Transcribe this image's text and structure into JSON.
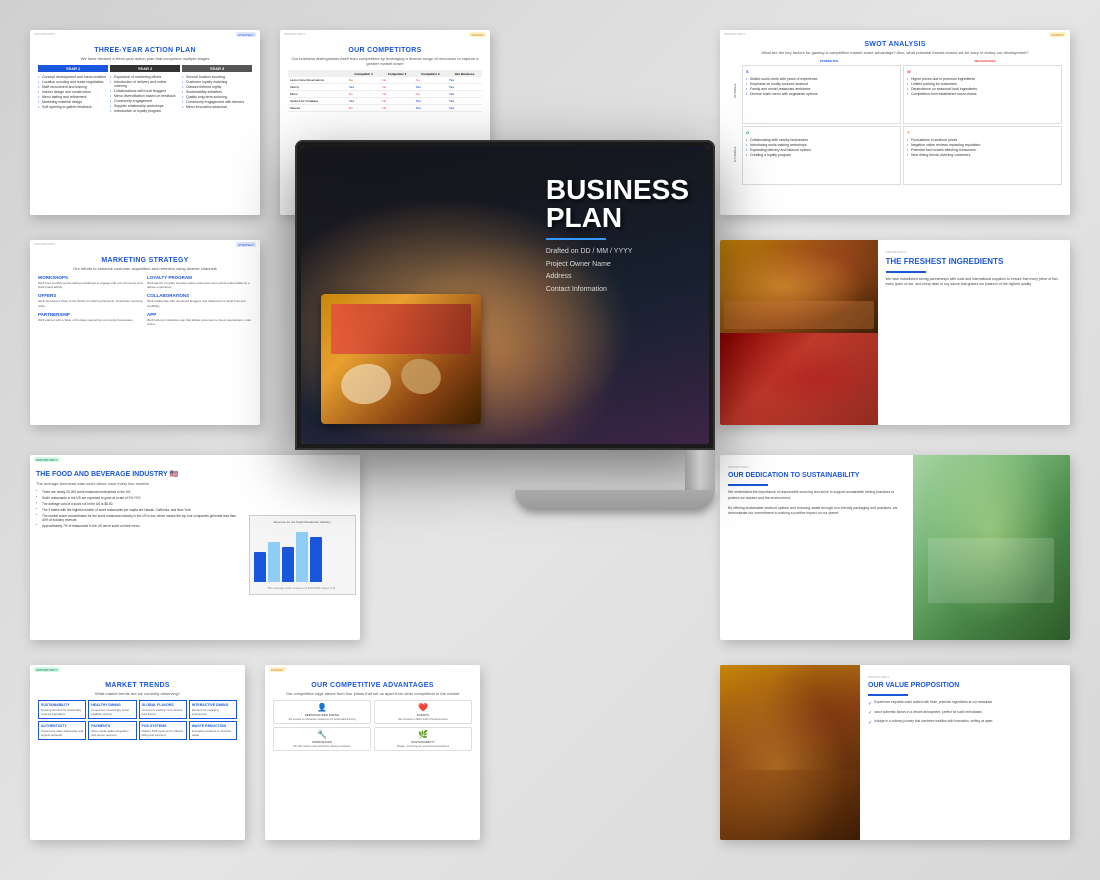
{
  "slides": {
    "action_plan": {
      "label": "STRATEGY",
      "title": "THREE-YEAR ACTION PLAN",
      "subtitle": "We have devised a three-year action plan that comprises multiple stages",
      "year1": "YEAR 1",
      "year2": "YEAR 2",
      "year3": "YEAR 3",
      "year1_items": [
        "Concept development and menu creation",
        "Location scouting and lease negotiation",
        "Staff recruitment and training initiation",
        "Interior design and construction commencement",
        "Menu tasting and refinement",
        "Marketing material design and branding",
        "Soft opening to gather feedback"
      ],
      "year2_items": [
        "Expansion of marketing efforts",
        "Introduction of delivery and online ordering",
        "Collaborations with local food bloggers",
        "Menu diversification based on customer feedback",
        "Community engagement and partnerships",
        "Supplier relationship workshops",
        "Introduction of loyalty program"
      ],
      "year3_items": [
        "Second location scouting and preparation",
        "Customer loyalty matching",
        "Classes themed nights",
        "Sustainability initiatives",
        "Strategies for quality long-term sourcing",
        "Community engagement with local suppliers and farmers",
        "Menu innovation and seasonal offerings"
      ]
    },
    "competitors": {
      "label": "MARKET",
      "title": "OUR COMPETITORS",
      "subtitle": "Our business distinguishes itself from competitors by leveraging a diverse range of resources to capture a greater market share",
      "columns": [
        "",
        "Competitor 1",
        "Competitor 2",
        "Competitor 3",
        "Our Business"
      ],
      "rows": [
        {
          "feature": "Last-minute Reservations",
          "c1": "No",
          "c2": "No",
          "c3": "No",
          "us": "Yes"
        },
        {
          "feature": "Variety",
          "c1": "Yes",
          "c2": "No",
          "c3": "Yes",
          "us": "Yes"
        },
        {
          "feature": "Menu",
          "c1": "No",
          "c2": "No",
          "c3": "No",
          "us": "Yes"
        },
        {
          "feature": "Options for Omakase",
          "c1": "Yes",
          "c2": "No",
          "c3": "Yes",
          "us": "Yes"
        },
        {
          "feature": "Sauces",
          "c1": "No",
          "c2": "No",
          "c3": "Yes",
          "us": "Yes"
        }
      ]
    },
    "swot": {
      "label": "MARKET",
      "title": "SWOT ANALYSIS",
      "subtitle": "What are the key factors for gaining a competitive market share advantage? Also, what potential threats should we be wary of during our development?",
      "strengths_title": "STRENGTHS",
      "weaknesses_title": "WEAKNESSES",
      "opportunities_title": "OPPORTUNITIES",
      "threats_title": "THREATS",
      "internal_label": "INTERNAL",
      "external_label": "EXTERNAL",
      "strengths": [
        "Skilled sushi chefs with years of experience",
        "Emphasis on using locally sourced seafood",
        "Family and model restaurant ambiance",
        "Diverse sushi menu with vegetarian options"
      ],
      "weaknesses": [
        "Higher prices due to premium ingredients",
        "Limited parking for customers",
        "Dependence on seasonal local ingredients",
        "May face competition from established sushi chains"
      ],
      "opportunities": [
        "Collaborating with nearby businesses for lunch specials",
        "Introducing sushi-making workshops for customers",
        "Expanding delivery and takeout options",
        "Creating a loyalty program to encourage repeat visits"
      ],
      "threats": [
        "Fluctuations in seafood prices due to supply chain issues",
        "Negative online reviews impacting reputation",
        "Potential food scares affecting consumer consumption",
        "Emergence of new dining trends diverting customer"
      ]
    },
    "marketing": {
      "label": "STRATEGY",
      "title": "MARKETING STRATEGY",
      "subtitle": "Our efforts to enhance customer acquisition and retention using diverse channels",
      "items": [
        {
          "title": "WORKSHOPS",
          "text": "We'll host monthly sushi-making workshops to engage with our community and build brand affinity."
        },
        {
          "title": "LOYALTY PROGRAM",
          "text": "We'll launch a loyalty program where customers earn points for a minimum spend, redeemable for a deluxe omakase experience."
        },
        {
          "title": "OFFERS",
          "text": "We'll introduce a Taste of the World cut offering discounts. Incentivize recurring visits."
        },
        {
          "title": "COLLABORATIONS",
          "text": "We'll collaborate with renowned high-profile bloggers and influencers to build trust and credibility."
        },
        {
          "title": "PARTNERSHIP",
          "text": "We'll partner with a Taste of the East supporting community businesses."
        },
        {
          "title": "APP",
          "text": "We'll build an interactive app that allows customers to book reservations, order online."
        }
      ]
    },
    "freshest": {
      "label": "OPPORTUNITY",
      "title": "THE FRESHEST INGREDIENTS",
      "text": "We have established strong partnerships with local and international suppliers to ensure that every piece of fish, every grain of rice, and every dash of soy sauce that graces our plates is of the highest quality.",
      "detection_text": "The freSHEST"
    },
    "food_beverage": {
      "label": "OPPORTUNITY",
      "title": "THE FOOD AND BEVERAGE INDUSTRY 🇺🇸",
      "subtitle": "The average American eats sushi about once every two months",
      "stats": [
        "There are nearly 20,000 sushi restaurant enterprises in the US.",
        "Sushi restaurants in the US are expected to grow at a rate of 2% YOY.",
        "The average cost of a sushi roll in the US is $8.50.",
        "The 3 states with the highest number of sushi restaurants per capita are Hawaii, California, and New York.",
        "The market share concentration for the sushi restaurant industry in the US is low, which means the top four companies generate less than 40% of industry revenue.",
        "Approximately 7% of restaurants in the US serve sushi on their menu."
      ]
    },
    "sustainability": {
      "label": "OPPORTUNITY",
      "title": "OUR DEDICATION TO SUSTAINABILITY",
      "text1": "We understand the importance of responsible sourcing and strive to support sustainable fishing practices to protect our oceans and the environment.",
      "text2": "By offering sustainable seafood options and reducing waste through eco-friendly packaging and practices, we demonstrate our commitment to making a positive impact on our planet."
    },
    "market_trends": {
      "label": "OPPORTUNITY",
      "title": "MARKET TRENDS",
      "subtitle": "What market trends are we currently observing?",
      "items": [
        {
          "title": "SUSTAINABILITY",
          "text": "Growing demand for sustainably sourced ingredients is leading to new positions in the restaurant"
        },
        {
          "title": "HEALTHY DINING",
          "text": "Consumers increasingly prefer healthier options, making sushi an appealing"
        },
        {
          "title": "GLOBAL FLAVORS",
          "text": "Customers are seeking more diverse food flavors and tastes"
        },
        {
          "title": "INTERACTIVE DINING",
          "text": "Demand for engaging experiences like live preparation"
        },
        {
          "title": "AUTHENTICITY",
          "text": "Consumers value authenticity and are willing to support restaurants with authentic"
        },
        {
          "title": "PAYMENTS",
          "text": "More and more mobile wallet integration and secure payment options"
        },
        {
          "title": "POS SYSTEMS",
          "text": "Modern POS systems for efficient billing and inventory management"
        },
        {
          "title": "WASTE REDUCTION",
          "text": "Innovative solutions to minimize waste and promote composting"
        }
      ]
    },
    "competitive_adv": {
      "label": "MARKET",
      "title": "OUR COMPETITIVE ADVANTAGES",
      "subtitle": "Our competitive edge stems from four pillars that set us apart from other competitors in the market",
      "pillars": [
        {
          "icon": "👤",
          "label": "PERSONALIZED DINING",
          "text": "We provide an interactive Tuna Omakase experience for personalized dining"
        },
        {
          "icon": "❤️",
          "label": "EVENTS",
          "text": "We introduce a Table Sushi Chef Experience to engage young professionals"
        },
        {
          "icon": "🔧",
          "label": "WORKSHOPS",
          "text": "We offer various chef workshops training customers to feel at ease with crafting"
        },
        {
          "icon": "🌿",
          "label": "SUSTAINABILITY",
          "text": "Pledge - improving our environmental practices"
        }
      ]
    },
    "value_prop": {
      "label": "OPPORTUNITY",
      "title": "OUR VALUE PROPOSITION",
      "items": [
        {
          "text": "Experience exquisite sushi crafted with fresh, premium ingredients at our restaurant."
        },
        {
          "text": "savor authentic flavors in a vibrant atmosphere, perfect for sushi enthusiasts."
        },
        {
          "text": "Indulge in a culinary journey that combines tradition with innovation, setting us apart."
        }
      ]
    },
    "center_slide": {
      "title": "BUSINESS",
      "title2": "PLAN",
      "drafted": "Drafted on DD / MM / YYYY",
      "project": "Project Owner Name",
      "address": "Address",
      "contact": "Contact Information"
    }
  }
}
